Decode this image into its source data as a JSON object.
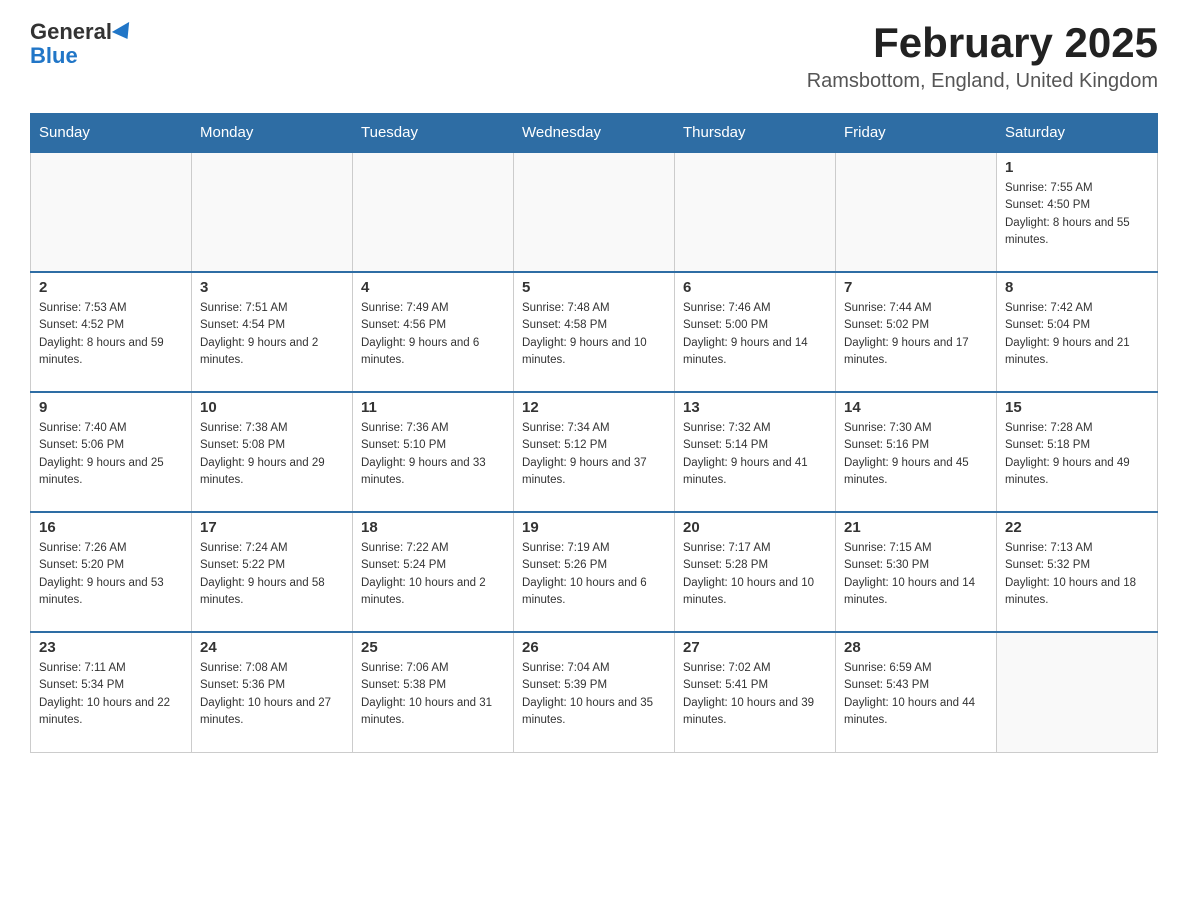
{
  "header": {
    "logo_general": "General",
    "logo_blue": "Blue",
    "title": "February 2025",
    "subtitle": "Ramsbottom, England, United Kingdom"
  },
  "days_of_week": [
    "Sunday",
    "Monday",
    "Tuesday",
    "Wednesday",
    "Thursday",
    "Friday",
    "Saturday"
  ],
  "weeks": [
    {
      "days": [
        {
          "number": "",
          "info": ""
        },
        {
          "number": "",
          "info": ""
        },
        {
          "number": "",
          "info": ""
        },
        {
          "number": "",
          "info": ""
        },
        {
          "number": "",
          "info": ""
        },
        {
          "number": "",
          "info": ""
        },
        {
          "number": "1",
          "info": "Sunrise: 7:55 AM\nSunset: 4:50 PM\nDaylight: 8 hours and 55 minutes."
        }
      ]
    },
    {
      "days": [
        {
          "number": "2",
          "info": "Sunrise: 7:53 AM\nSunset: 4:52 PM\nDaylight: 8 hours and 59 minutes."
        },
        {
          "number": "3",
          "info": "Sunrise: 7:51 AM\nSunset: 4:54 PM\nDaylight: 9 hours and 2 minutes."
        },
        {
          "number": "4",
          "info": "Sunrise: 7:49 AM\nSunset: 4:56 PM\nDaylight: 9 hours and 6 minutes."
        },
        {
          "number": "5",
          "info": "Sunrise: 7:48 AM\nSunset: 4:58 PM\nDaylight: 9 hours and 10 minutes."
        },
        {
          "number": "6",
          "info": "Sunrise: 7:46 AM\nSunset: 5:00 PM\nDaylight: 9 hours and 14 minutes."
        },
        {
          "number": "7",
          "info": "Sunrise: 7:44 AM\nSunset: 5:02 PM\nDaylight: 9 hours and 17 minutes."
        },
        {
          "number": "8",
          "info": "Sunrise: 7:42 AM\nSunset: 5:04 PM\nDaylight: 9 hours and 21 minutes."
        }
      ]
    },
    {
      "days": [
        {
          "number": "9",
          "info": "Sunrise: 7:40 AM\nSunset: 5:06 PM\nDaylight: 9 hours and 25 minutes."
        },
        {
          "number": "10",
          "info": "Sunrise: 7:38 AM\nSunset: 5:08 PM\nDaylight: 9 hours and 29 minutes."
        },
        {
          "number": "11",
          "info": "Sunrise: 7:36 AM\nSunset: 5:10 PM\nDaylight: 9 hours and 33 minutes."
        },
        {
          "number": "12",
          "info": "Sunrise: 7:34 AM\nSunset: 5:12 PM\nDaylight: 9 hours and 37 minutes."
        },
        {
          "number": "13",
          "info": "Sunrise: 7:32 AM\nSunset: 5:14 PM\nDaylight: 9 hours and 41 minutes."
        },
        {
          "number": "14",
          "info": "Sunrise: 7:30 AM\nSunset: 5:16 PM\nDaylight: 9 hours and 45 minutes."
        },
        {
          "number": "15",
          "info": "Sunrise: 7:28 AM\nSunset: 5:18 PM\nDaylight: 9 hours and 49 minutes."
        }
      ]
    },
    {
      "days": [
        {
          "number": "16",
          "info": "Sunrise: 7:26 AM\nSunset: 5:20 PM\nDaylight: 9 hours and 53 minutes."
        },
        {
          "number": "17",
          "info": "Sunrise: 7:24 AM\nSunset: 5:22 PM\nDaylight: 9 hours and 58 minutes."
        },
        {
          "number": "18",
          "info": "Sunrise: 7:22 AM\nSunset: 5:24 PM\nDaylight: 10 hours and 2 minutes."
        },
        {
          "number": "19",
          "info": "Sunrise: 7:19 AM\nSunset: 5:26 PM\nDaylight: 10 hours and 6 minutes."
        },
        {
          "number": "20",
          "info": "Sunrise: 7:17 AM\nSunset: 5:28 PM\nDaylight: 10 hours and 10 minutes."
        },
        {
          "number": "21",
          "info": "Sunrise: 7:15 AM\nSunset: 5:30 PM\nDaylight: 10 hours and 14 minutes."
        },
        {
          "number": "22",
          "info": "Sunrise: 7:13 AM\nSunset: 5:32 PM\nDaylight: 10 hours and 18 minutes."
        }
      ]
    },
    {
      "days": [
        {
          "number": "23",
          "info": "Sunrise: 7:11 AM\nSunset: 5:34 PM\nDaylight: 10 hours and 22 minutes."
        },
        {
          "number": "24",
          "info": "Sunrise: 7:08 AM\nSunset: 5:36 PM\nDaylight: 10 hours and 27 minutes."
        },
        {
          "number": "25",
          "info": "Sunrise: 7:06 AM\nSunset: 5:38 PM\nDaylight: 10 hours and 31 minutes."
        },
        {
          "number": "26",
          "info": "Sunrise: 7:04 AM\nSunset: 5:39 PM\nDaylight: 10 hours and 35 minutes."
        },
        {
          "number": "27",
          "info": "Sunrise: 7:02 AM\nSunset: 5:41 PM\nDaylight: 10 hours and 39 minutes."
        },
        {
          "number": "28",
          "info": "Sunrise: 6:59 AM\nSunset: 5:43 PM\nDaylight: 10 hours and 44 minutes."
        },
        {
          "number": "",
          "info": ""
        }
      ]
    }
  ]
}
